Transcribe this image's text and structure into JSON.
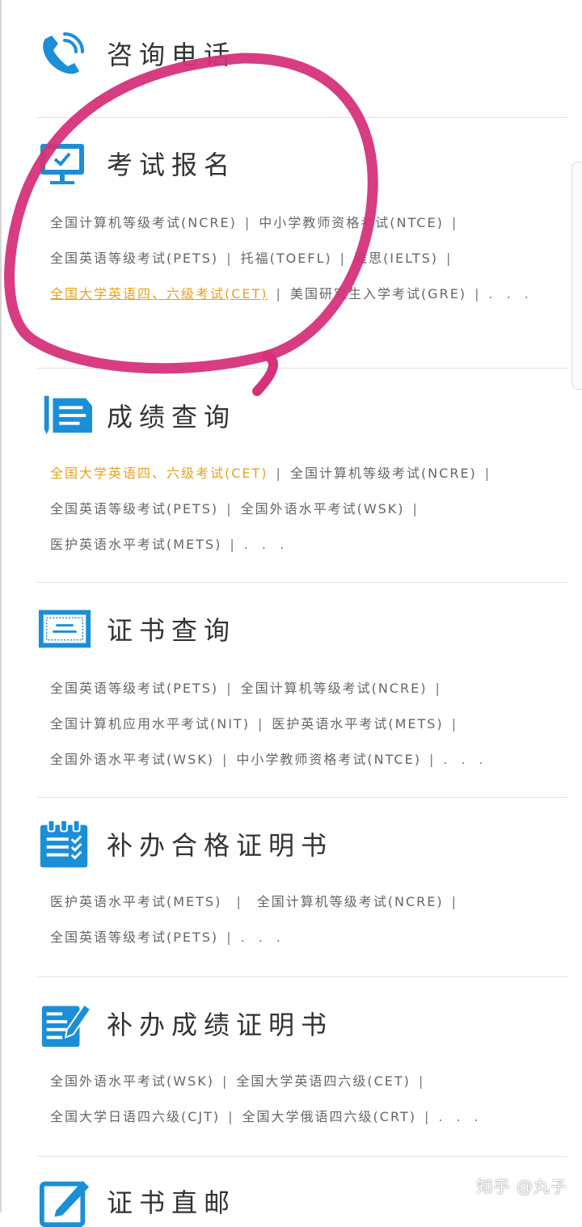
{
  "sections": [
    {
      "title": "咨询电话",
      "links": []
    },
    {
      "title": "考试报名",
      "links": [
        [
          "全国计算机等级考试(NCRE)",
          "中小学教师资格考试(NTCE)"
        ],
        [
          "全国英语等级考试(PETS)",
          "托福(TOEFL)",
          "雅思(IELTS)"
        ],
        [
          "全国大学英语四、六级考试(CET)",
          "美国研究生入学考试(GRE)"
        ]
      ],
      "more": ". . ."
    },
    {
      "title": "成绩查询",
      "links": [
        [
          "全国大学英语四、六级考试(CET)",
          "全国计算机等级考试(NCRE)"
        ],
        [
          "全国英语等级考试(PETS)",
          "全国外语水平考试(WSK)"
        ],
        [
          "医护英语水平考试(METS)"
        ]
      ],
      "more": ". . ."
    },
    {
      "title": "证书查询",
      "links": [
        [
          "全国英语等级考试(PETS)",
          "全国计算机等级考试(NCRE)"
        ],
        [
          "全国计算机应用水平考试(NIT)",
          "医护英语水平考试(METS)"
        ],
        [
          "全国外语水平考试(WSK)",
          "中小学教师资格考试(NTCE)"
        ]
      ],
      "more": ". . ."
    },
    {
      "title": "补办合格证明书",
      "links": [
        [
          "医护英语水平考试(METS)",
          "全国计算机等级考试(NCRE)"
        ],
        [
          "全国英语等级考试(PETS)"
        ]
      ],
      "more": ". . ."
    },
    {
      "title": "补办成绩证明书",
      "links": [
        [
          "全国外语水平考试(WSK)",
          "全国大学英语四六级(CET)"
        ],
        [
          "全国大学日语四六级(CJT)",
          "全国大学俄语四六级(CRT)"
        ]
      ],
      "more": ". . ."
    },
    {
      "title": "证书直邮",
      "links": []
    }
  ],
  "watermark": "知乎 @丸子",
  "colors": {
    "icon_blue": "#1a8fd8",
    "highlight": "#e8a11f",
    "annotation": "#d6317a"
  }
}
